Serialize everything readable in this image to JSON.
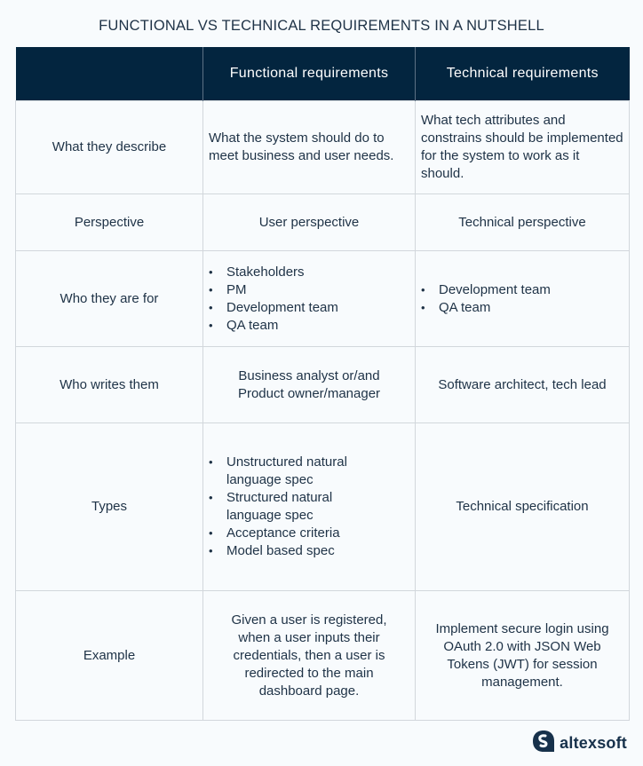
{
  "title": "FUNCTIONAL VS TECHNICAL REQUIREMENTS IN A NUTSHELL",
  "table": {
    "headers": [
      "",
      "Functional requirements",
      "Technical requirements"
    ],
    "rows": [
      {
        "label": "What they describe",
        "functional": "What the system should do to meet business and user needs.",
        "technical": "What tech attributes and constrains should be implemented for the system to work as it should."
      },
      {
        "label": "Perspective",
        "functional": "User perspective",
        "technical": "Technical perspective"
      },
      {
        "label": "Who they are for",
        "functional_list": [
          "Stakeholders",
          "PM",
          "Development team",
          "QA team"
        ],
        "technical_list": [
          "Development team",
          "QA team"
        ]
      },
      {
        "label": "Who writes them",
        "functional": "Business analyst or/and Product owner/manager",
        "technical": "Software architect, tech lead"
      },
      {
        "label": "Types",
        "functional_list": [
          "Unstructured natural language spec",
          "Structured natural language spec",
          "Acceptance criteria",
          "Model based spec"
        ],
        "technical": "Technical specification"
      },
      {
        "label": "Example",
        "functional": "Given a user is registered, when a user inputs their credentials, then a user is redirected to the main dashboard page.",
        "technical": "Implement secure login using OAuth 2.0 with JSON Web Tokens (JWT) for session management."
      }
    ]
  },
  "brand": {
    "name": "altexsoft",
    "icon": "altexsoft-logo-icon",
    "color": "#17314b"
  },
  "colors": {
    "header_bg": "#03253f",
    "text": "#1e3246",
    "border": "#d2d7dc",
    "background": "#f8fbfd"
  }
}
